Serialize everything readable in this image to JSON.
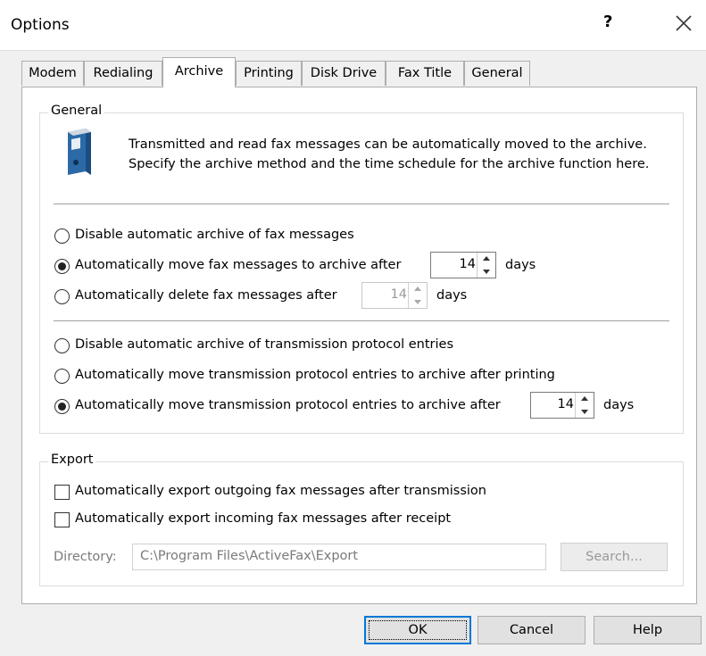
{
  "window": {
    "title": "Options",
    "help_glyph": "?",
    "close_icon": "close-icon"
  },
  "tabs": [
    {
      "label": "Modem",
      "active": false
    },
    {
      "label": "Redialing",
      "active": false
    },
    {
      "label": "Archive",
      "active": true
    },
    {
      "label": "Printing",
      "active": false
    },
    {
      "label": "Disk Drive",
      "active": false
    },
    {
      "label": "Fax Title",
      "active": false
    },
    {
      "label": "General",
      "active": false
    }
  ],
  "general_group": {
    "legend": "General",
    "icon": "binder-icon",
    "description": "Transmitted and read fax messages can be automatically moved to the archive. Specify the archive method and the time schedule for the archive function here.",
    "fax_options": [
      {
        "label": "Disable automatic archive of fax messages",
        "checked": false
      },
      {
        "label": "Automatically move fax messages to archive after",
        "checked": true,
        "days": "14",
        "unit": "days"
      },
      {
        "label": "Automatically delete fax messages after",
        "checked": false,
        "days": "14",
        "unit": "days",
        "disabled": true
      }
    ],
    "protocol_options": [
      {
        "label": "Disable automatic archive of transmission protocol entries",
        "checked": false
      },
      {
        "label": "Automatically move transmission protocol entries to archive after printing",
        "checked": false
      },
      {
        "label": "Automatically move transmission protocol entries to archive after",
        "checked": true,
        "days": "14",
        "unit": "days"
      }
    ]
  },
  "export_group": {
    "legend": "Export",
    "options": [
      {
        "label": "Automatically export outgoing fax messages after transmission",
        "checked": false
      },
      {
        "label": "Automatically export incoming fax messages after receipt",
        "checked": false
      }
    ],
    "directory_label": "Directory:",
    "directory_value": "C:\\Program Files\\ActiveFax\\Export",
    "search_label": "Search..."
  },
  "buttons": {
    "ok": "OK",
    "cancel": "Cancel",
    "help": "Help"
  },
  "colors": {
    "window_bg": "#f0f0f0",
    "panel_bg": "#ffffff",
    "accent": "#0078d7"
  }
}
